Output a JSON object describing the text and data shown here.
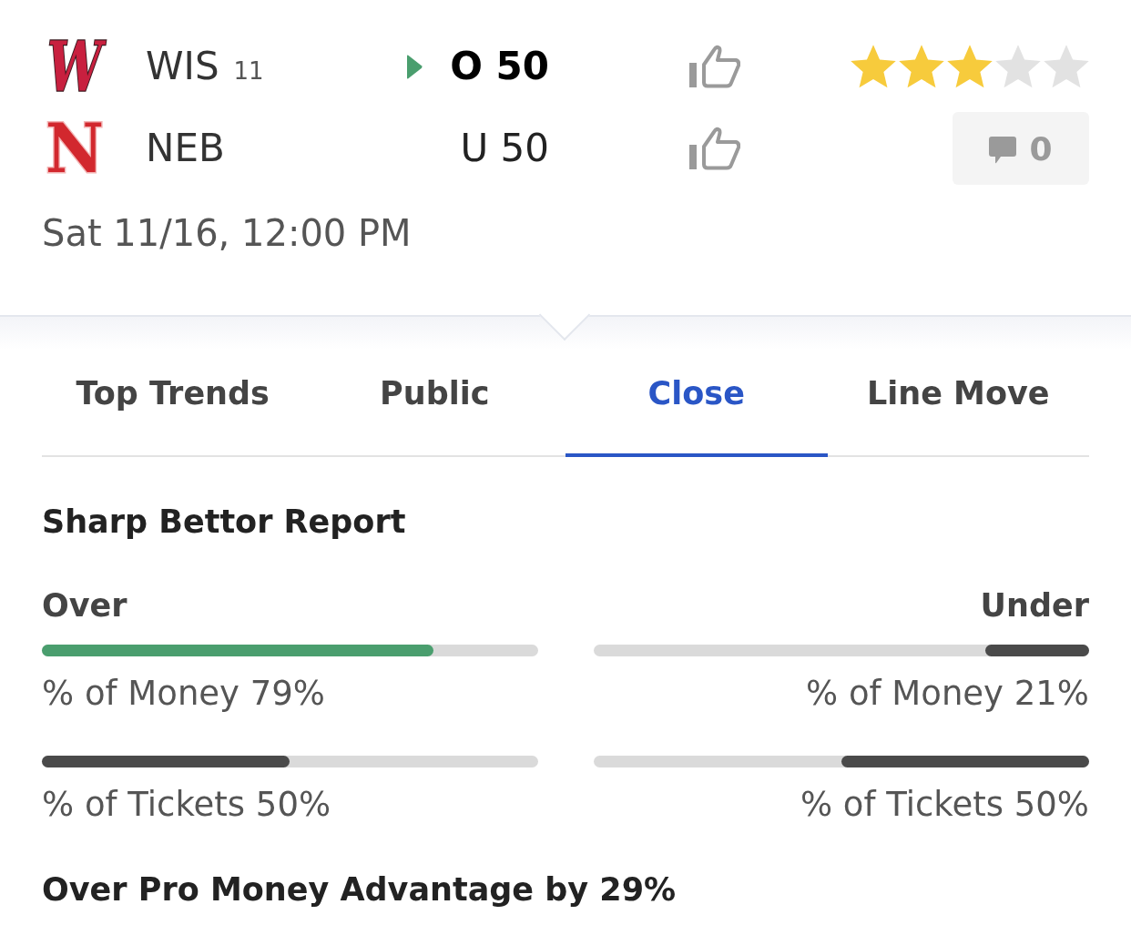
{
  "matchup": {
    "teams": [
      {
        "logo": "W",
        "abbr": "WIS",
        "rank": "11",
        "line": "O 50",
        "picked": true
      },
      {
        "logo": "N",
        "abbr": "NEB",
        "line": "U 50",
        "picked": false
      }
    ],
    "rating": {
      "stars": 3
    },
    "comments": {
      "count": "0"
    },
    "start_time": "Sat 11/16, 12:00 PM"
  },
  "tabs": [
    {
      "label": "Top Trends",
      "selected": false
    },
    {
      "label": "Public",
      "selected": false
    },
    {
      "label": "Close",
      "selected": true
    },
    {
      "label": "Line Move",
      "selected": false
    }
  ],
  "report": {
    "title": "Sharp Bettor Report",
    "sides": [
      {
        "label": "Over",
        "metrics": [
          {
            "label": "% of Money 79%",
            "level": 0.79,
            "highlighted": true
          },
          {
            "label": "% of Tickets 50%",
            "level": 0.5,
            "highlighted": false
          }
        ]
      },
      {
        "label": "Under",
        "metrics": [
          {
            "label": "% of Money 21%",
            "level": 0.21,
            "highlighted": false
          },
          {
            "label": "% of Tickets 50%",
            "level": 0.5,
            "highlighted": false
          }
        ]
      }
    ],
    "summary": "Over Pro Money Advantage by 29%"
  }
}
